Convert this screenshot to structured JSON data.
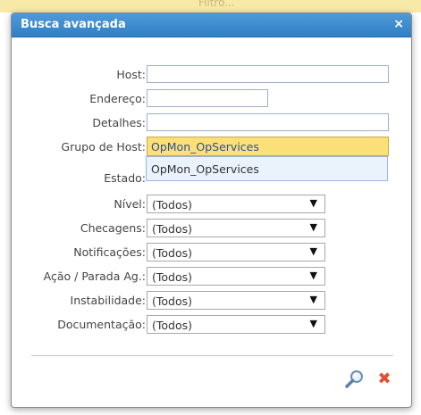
{
  "background": {
    "strip_text": "Filtro..."
  },
  "dialog": {
    "title": "Busca avançada",
    "close_glyph": "×",
    "fields": {
      "host": {
        "label": "Host:",
        "value": ""
      },
      "endereco": {
        "label": "Endereço:",
        "value": ""
      },
      "detalhes": {
        "label": "Detalhes:",
        "value": ""
      },
      "grupo_de_host": {
        "label": "Grupo de Host:",
        "value": "OpMon_OpServices"
      },
      "estado": {
        "label": "Estado:"
      }
    },
    "dropdown": {
      "options": [
        "OpMon_OpServices"
      ]
    },
    "selects": {
      "nivel": {
        "label": "Nível:",
        "value": "(Todos)"
      },
      "checagens": {
        "label": "Checagens:",
        "value": "(Todos)"
      },
      "notificacoes": {
        "label": "Notificações:",
        "value": "(Todos)"
      },
      "acao_parada": {
        "label": "Ação / Parada Ag.:",
        "value": "(Todos)"
      },
      "instabilidade": {
        "label": "Instabilidade:",
        "value": "(Todos)"
      },
      "documentacao": {
        "label": "Documentação:",
        "value": "(Todos)"
      }
    },
    "select_arrow": "▼",
    "buttons": {
      "cancel_glyph": "✖"
    }
  },
  "colors": {
    "title_bar": "#3a88cf",
    "combo_highlight": "#fbe07a",
    "dropdown_bg": "#eaf2fc",
    "cancel": "#e0512e"
  },
  "icons": {
    "search": "search-icon",
    "cancel": "cancel-icon",
    "close": "close-icon"
  }
}
